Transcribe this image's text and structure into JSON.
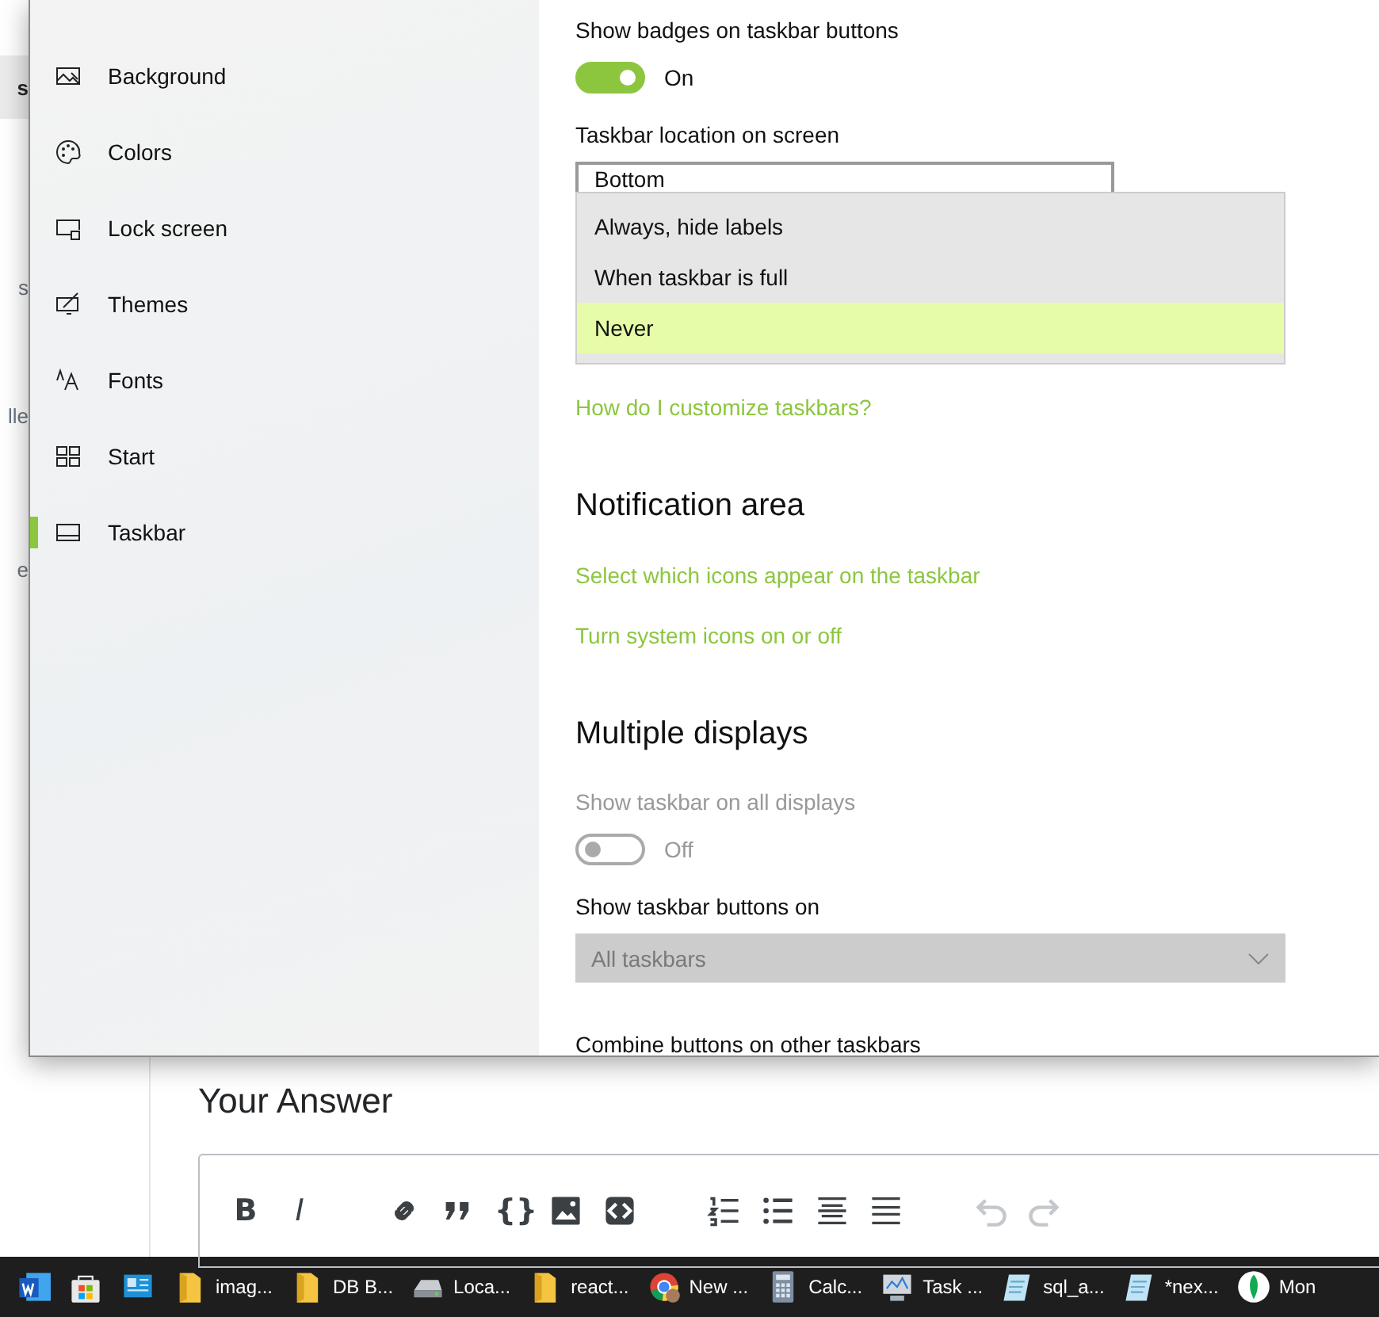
{
  "background_page": {
    "side_fragments": [
      {
        "text": "s",
        "selected": true
      },
      {
        "text": "s",
        "selected": false
      },
      {
        "text": "lle",
        "selected": false
      },
      {
        "text": "e",
        "selected": false
      }
    ],
    "heading": "Your Answer",
    "editor_toolbar": [
      {
        "kind": "bold",
        "label": "B"
      },
      {
        "kind": "italic",
        "label": "I"
      },
      {
        "kind": "link"
      },
      {
        "kind": "quote"
      },
      {
        "kind": "braces",
        "label": "{}"
      },
      {
        "kind": "image"
      },
      {
        "kind": "snippet"
      },
      {
        "kind": "olist"
      },
      {
        "kind": "ulist"
      },
      {
        "kind": "heading"
      },
      {
        "kind": "rule"
      },
      {
        "kind": "undo"
      },
      {
        "kind": "redo"
      }
    ]
  },
  "settings_window": {
    "sidebar": {
      "items": [
        {
          "label": "Background",
          "kind": "picture",
          "selected": false
        },
        {
          "label": "Colors",
          "kind": "palette",
          "selected": false
        },
        {
          "label": "Lock screen",
          "kind": "lock",
          "selected": false
        },
        {
          "label": "Themes",
          "kind": "brush",
          "selected": false
        },
        {
          "label": "Fonts",
          "kind": "fonts",
          "selected": false
        },
        {
          "label": "Start",
          "kind": "start",
          "selected": false
        },
        {
          "label": "Taskbar",
          "kind": "taskbar",
          "selected": true
        }
      ]
    },
    "content": {
      "badges": {
        "label": "Show badges on taskbar buttons",
        "toggle": {
          "on": true,
          "disabled": false,
          "state_text": "On"
        }
      },
      "location": {
        "label": "Taskbar location on screen",
        "value": "Bottom"
      },
      "combine_popup": {
        "options": [
          {
            "label": "Always, hide labels",
            "selected": false
          },
          {
            "label": "When taskbar is full",
            "selected": false
          },
          {
            "label": "Never",
            "selected": true
          }
        ]
      },
      "help_link": "How do I customize taskbars?",
      "notification_area": {
        "heading": "Notification area",
        "links": [
          "Select which icons appear on the taskbar",
          "Turn system icons on or off"
        ]
      },
      "multiple_displays": {
        "heading": "Multiple displays",
        "show_all": {
          "label": "Show taskbar on all displays",
          "toggle": {
            "on": false,
            "disabled": true,
            "state_text": "Off"
          }
        },
        "buttons_on": {
          "label": "Show taskbar buttons on",
          "value": "All taskbars",
          "disabled": true
        },
        "combine_label": "Combine buttons on other taskbars"
      }
    }
  },
  "taskbar": {
    "items": [
      {
        "kind": "word"
      },
      {
        "kind": "store"
      },
      {
        "kind": "app"
      },
      {
        "kind": "folder",
        "label": "imag..."
      },
      {
        "kind": "folder",
        "label": "DB B..."
      },
      {
        "kind": "drive",
        "label": "Loca..."
      },
      {
        "kind": "folder",
        "label": "react..."
      },
      {
        "kind": "browser",
        "label": "New ..."
      },
      {
        "kind": "calculator",
        "label": "Calc..."
      },
      {
        "kind": "monitor",
        "label": "Task ..."
      },
      {
        "kind": "notepad",
        "label": "sql_a..."
      },
      {
        "kind": "notepad",
        "label": "*nex..."
      },
      {
        "kind": "leaf",
        "label": "Mon"
      }
    ]
  }
}
